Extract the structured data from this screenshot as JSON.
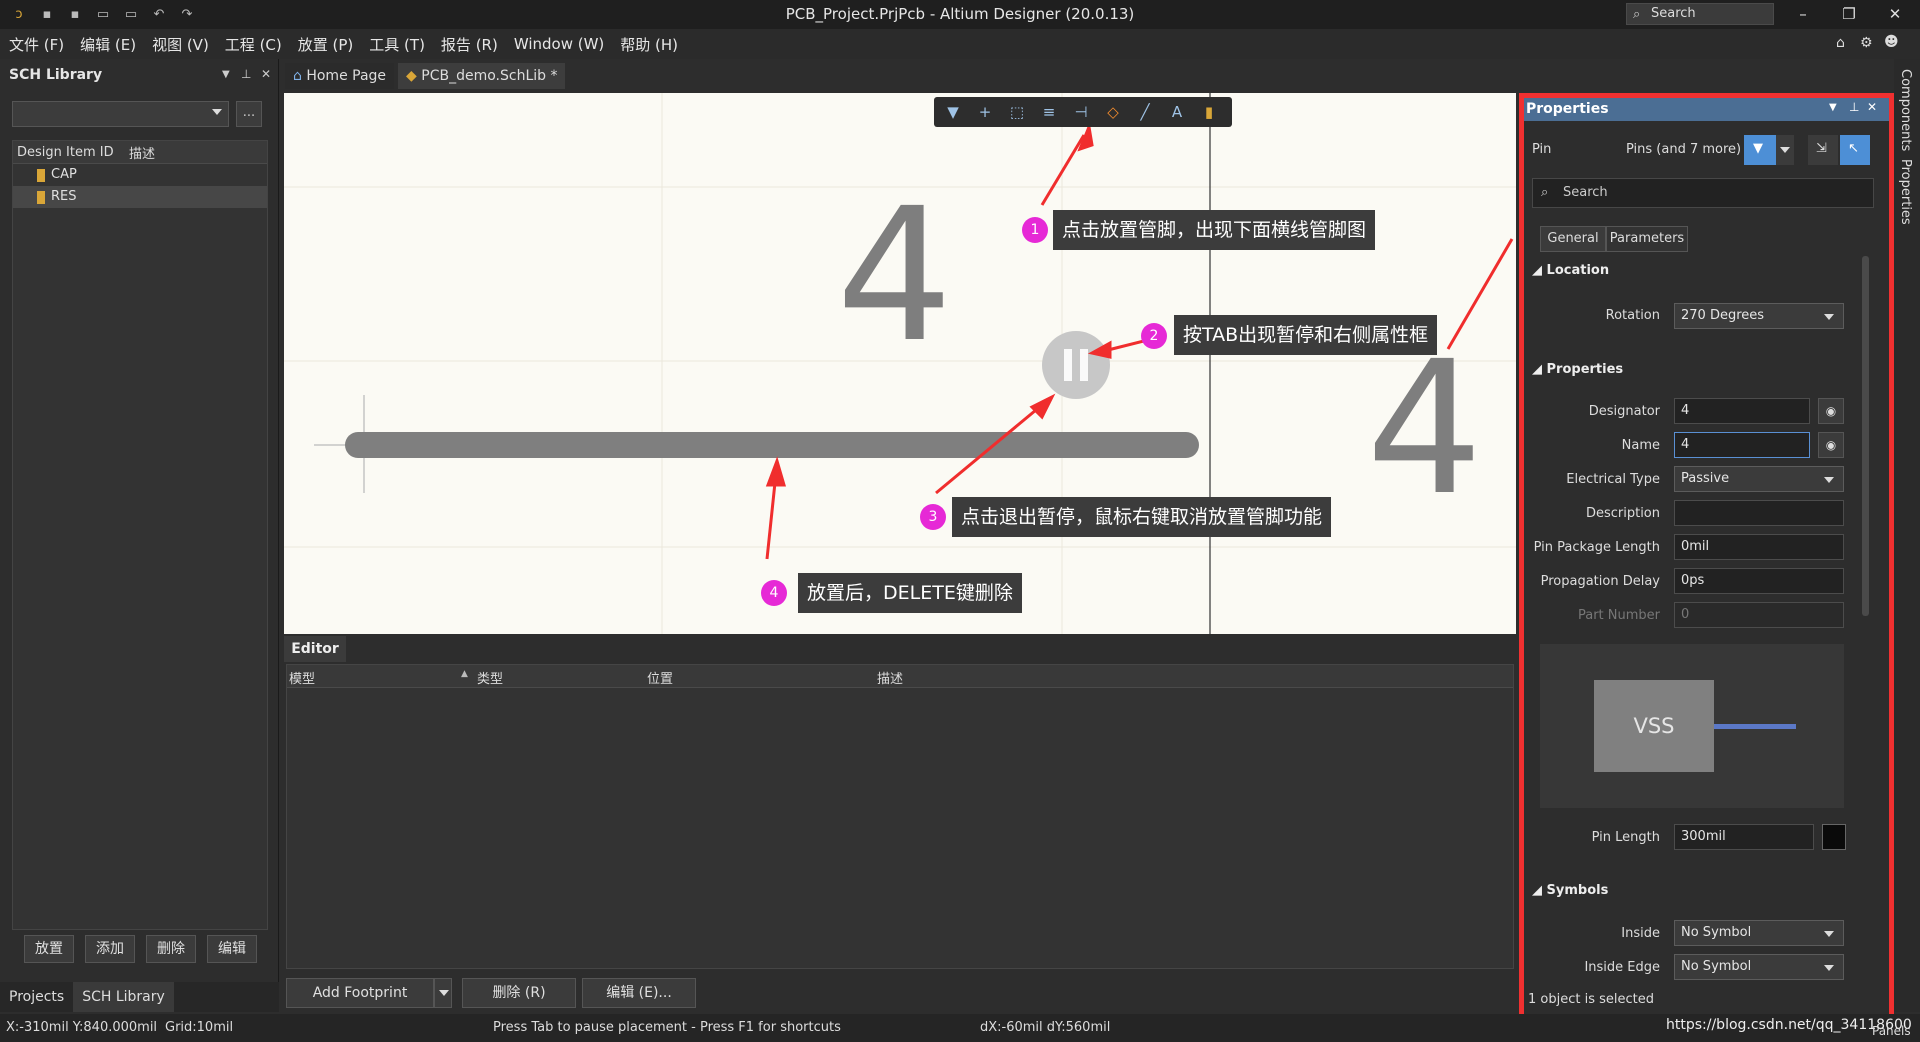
{
  "window": {
    "title": "PCB_Project.PrjPcb - Altium Designer (20.0.13)",
    "search_label": "Search"
  },
  "menu": [
    "文件 (F)",
    "编辑 (E)",
    "视图 (V)",
    "工程 (C)",
    "放置 (P)",
    "工具 (T)",
    "报告 (R)",
    "Window (W)",
    "帮助 (H)"
  ],
  "left_panel": {
    "title": "SCH Library",
    "browse_button": "...",
    "columns": [
      "Design Item ID",
      "描述"
    ],
    "items": [
      {
        "id": "CAP",
        "selected": false
      },
      {
        "id": "RES",
        "selected": true
      }
    ],
    "buttons": [
      "放置",
      "添加",
      "删除",
      "编辑"
    ],
    "bottom_tabs": [
      "Projects",
      "SCH Library"
    ]
  },
  "doc_tabs": [
    {
      "label": "Home Page",
      "active": false
    },
    {
      "label": "PCB_demo.SchLib *",
      "active": true
    }
  ],
  "canvas": {
    "designator_big": "4",
    "callouts": [
      {
        "num": "1",
        "text": "点击放置管脚，出现下面横线管脚图"
      },
      {
        "num": "2",
        "text": "按TAB出现暂停和右侧属性框"
      },
      {
        "num": "3",
        "text": "点击退出暂停，鼠标右键取消放置管脚功能"
      },
      {
        "num": "4",
        "text": "放置后，DELETE键删除"
      }
    ],
    "accent": "#e629d6"
  },
  "editor": {
    "tab": "Editor",
    "columns": [
      "模型",
      "类型",
      "位置",
      "描述"
    ],
    "buttons": {
      "add_footprint": "Add Footprint",
      "delete": "删除 (R)",
      "edit": "编辑 (E)..."
    }
  },
  "properties": {
    "title": "Properties",
    "object_type": "Pin",
    "filter_text": "Pins (and 7 more)",
    "search_placeholder": "Search",
    "tabs": [
      "General",
      "Parameters"
    ],
    "location_header": "Location",
    "rotation_label": "Rotation",
    "rotation_value": "270 Degrees",
    "properties_header": "Properties",
    "designator_label": "Designator",
    "designator_value": "4",
    "name_label": "Name",
    "name_value": "4",
    "electrical_type_label": "Electrical Type",
    "electrical_type_value": "Passive",
    "description_label": "Description",
    "description_value": "",
    "pin_package_length_label": "Pin Package Length",
    "pin_package_length_value": "0mil",
    "propagation_delay_label": "Propagation Delay",
    "propagation_delay_value": "0ps",
    "part_number_label": "Part Number",
    "part_number_value": "0",
    "preview_label": "VSS",
    "pin_length_label": "Pin Length",
    "pin_length_value": "300mil",
    "symbols_header": "Symbols",
    "inside_label": "Inside",
    "inside_value": "No Symbol",
    "inside_edge_label": "Inside Edge",
    "inside_edge_value": "No Symbol",
    "status": "1 object is selected",
    "title_bar_color": "#4b6e94",
    "highlight_color": "#f03030"
  },
  "side_tabs": [
    "Components",
    "Properties"
  ],
  "status_bar": {
    "coords": "X:-310mil Y:840.000mil",
    "grid": "Grid:10mil",
    "hint": "Press Tab to pause placement - Press F1 for shortcuts",
    "delta": "dX:-60mil dY:560mil",
    "panels": "Panels",
    "watermark": "https://blog.csdn.net/qq_34118600"
  }
}
